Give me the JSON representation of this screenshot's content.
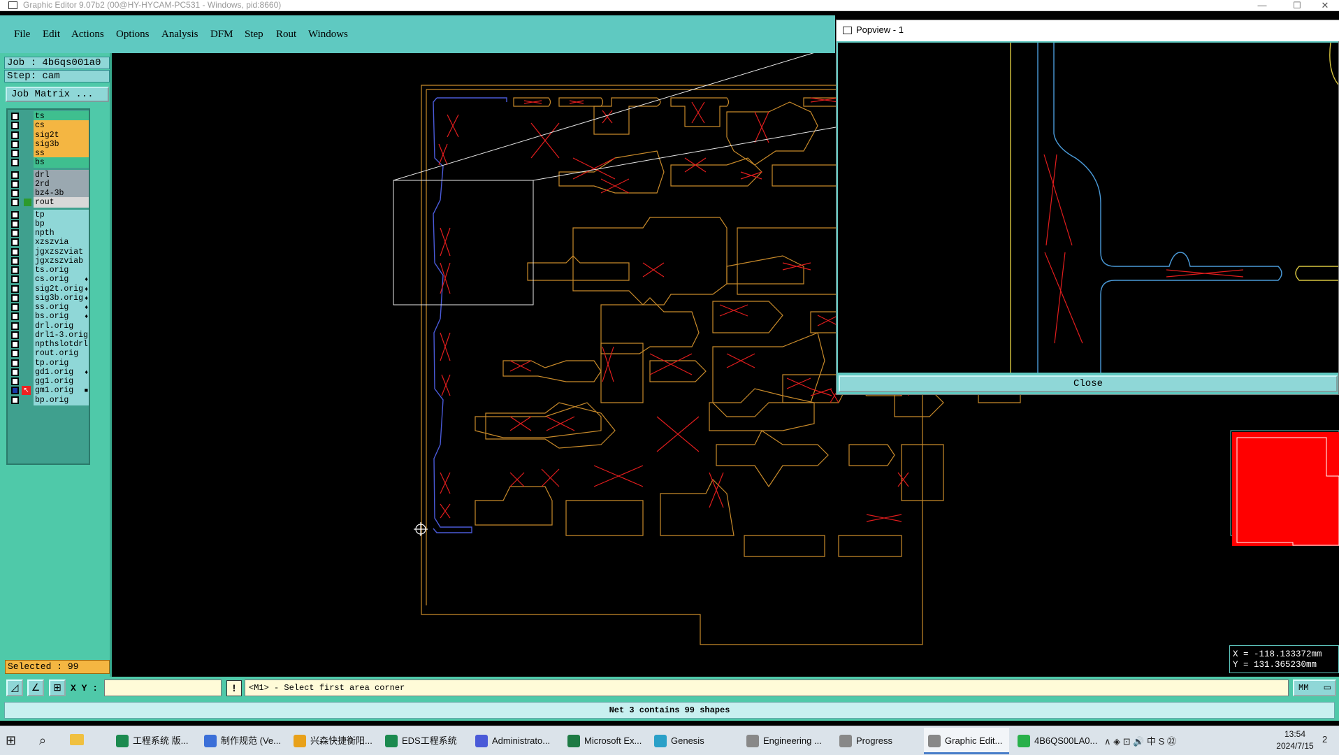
{
  "window": {
    "title": "Graphic Editor 9.07b2 (00@HY-HYCAM-PC531 - Windows, pid:8660)",
    "min_glyph": "—",
    "max_glyph": "☐",
    "close_glyph": "✕"
  },
  "menu": [
    "File",
    "Edit",
    "Actions",
    "Options",
    "Analysis",
    "DFM",
    "Step",
    "Rout",
    "Windows"
  ],
  "job": {
    "label": "Job : 4b6qs001a0",
    "step": "Step: cam",
    "matrix_button": "Job Matrix ..."
  },
  "layers": [
    {
      "name": "ts",
      "color": "#3fbf8f",
      "mark": "",
      "pointer": false
    },
    {
      "name": "cs",
      "color": "#f4b642",
      "mark": "",
      "pointer": false
    },
    {
      "name": "sig2t",
      "color": "#f4b642",
      "mark": "",
      "pointer": false
    },
    {
      "name": "sig3b",
      "color": "#f4b642",
      "mark": "",
      "pointer": false
    },
    {
      "name": "ss",
      "color": "#f4b642",
      "mark": "",
      "pointer": false
    },
    {
      "name": "bs",
      "color": "#3fbf8f",
      "mark": "",
      "pointer": false
    },
    {
      "name": "drl",
      "color": "#9aa8b0",
      "mark": "",
      "pointer": false
    },
    {
      "name": "2rd",
      "color": "#9aa8b0",
      "mark": "",
      "pointer": false
    },
    {
      "name": "bz4-3b",
      "color": "#9aa8b0",
      "mark": "",
      "pointer": false
    },
    {
      "name": "rout",
      "color": "#d8d8d8",
      "mark": "",
      "pointer": false,
      "active": true
    },
    {
      "name": "tp",
      "color": "#8fd7d7",
      "mark": "",
      "pointer": false
    },
    {
      "name": "bp",
      "color": "#8fd7d7",
      "mark": "",
      "pointer": false
    },
    {
      "name": "npth",
      "color": "#8fd7d7",
      "mark": "",
      "pointer": false
    },
    {
      "name": "xzszvia",
      "color": "#8fd7d7",
      "mark": "",
      "pointer": false
    },
    {
      "name": "jgxzszviat",
      "color": "#8fd7d7",
      "mark": "",
      "pointer": false
    },
    {
      "name": "jgxzszviab",
      "color": "#8fd7d7",
      "mark": "",
      "pointer": false
    },
    {
      "name": "ts.orig",
      "color": "#8fd7d7",
      "mark": "",
      "pointer": false
    },
    {
      "name": "cs.orig",
      "color": "#8fd7d7",
      "mark": "♦",
      "pointer": false
    },
    {
      "name": "sig2t.orig",
      "color": "#8fd7d7",
      "mark": "♦",
      "pointer": false
    },
    {
      "name": "sig3b.orig",
      "color": "#8fd7d7",
      "mark": "♦",
      "pointer": false
    },
    {
      "name": "ss.orig",
      "color": "#8fd7d7",
      "mark": "♦",
      "pointer": false
    },
    {
      "name": "bs.orig",
      "color": "#8fd7d7",
      "mark": "♦",
      "pointer": false
    },
    {
      "name": "drl.orig",
      "color": "#8fd7d7",
      "mark": "",
      "pointer": false
    },
    {
      "name": "drl1-3.orig",
      "color": "#8fd7d7",
      "mark": "",
      "pointer": false
    },
    {
      "name": "npthslotdrl",
      "color": "#8fd7d7",
      "mark": "",
      "pointer": false
    },
    {
      "name": "rout.orig",
      "color": "#8fd7d7",
      "mark": "",
      "pointer": false
    },
    {
      "name": "tp.orig",
      "color": "#8fd7d7",
      "mark": "",
      "pointer": false
    },
    {
      "name": "gd1.orig",
      "color": "#8fd7d7",
      "mark": "♦",
      "pointer": false
    },
    {
      "name": "gg1.orig",
      "color": "#8fd7d7",
      "mark": "",
      "pointer": false
    },
    {
      "name": "gm1.orig",
      "color": "#8fd7d7",
      "mark": "■",
      "pointer": true
    },
    {
      "name": "bp.orig",
      "color": "#8fd7d7",
      "mark": "",
      "pointer": false
    }
  ],
  "selected": "Selected : 99",
  "popview": {
    "title": "Popview - 1",
    "close_label": "Close"
  },
  "coords": {
    "x": "X = -118.133372mm",
    "y": "Y = 131.365230mm"
  },
  "cmd": {
    "xy_label": "X Y :",
    "xy_value": "",
    "bang": "!",
    "prompt": "<M1> - Select first area corner",
    "unit": "MM"
  },
  "status": "Net 3 contains 99 shapes",
  "colors": {
    "profile": "#c88a2a",
    "rout_blue": "#4a5ad8",
    "cut_red": "#e11d1d",
    "popview_bg": "#5fc9c1",
    "panel": "#4fc9a9"
  },
  "taskbar": {
    "items": [
      {
        "label": "工程系统 版...",
        "icon_color": "#1b8a4f",
        "active": false
      },
      {
        "label": "制作规范 (Ve...",
        "icon_color": "#3b6fd8",
        "active": false
      },
      {
        "label": "兴森快捷衡阳...",
        "icon_color": "#e8a11a",
        "active": false
      },
      {
        "label": "EDS工程系统",
        "icon_color": "#1b8a4f",
        "active": false
      },
      {
        "label": "Administrato...",
        "icon_color": "#4a5ad8",
        "active": false
      },
      {
        "label": "Microsoft Ex...",
        "icon_color": "#1d7a44",
        "active": false
      },
      {
        "label": "Genesis",
        "icon_color": "#2aa0c8",
        "active": false
      },
      {
        "label": "Engineering ...",
        "icon_color": "#888888",
        "active": false
      },
      {
        "label": "Progress",
        "icon_color": "#888888",
        "active": false
      },
      {
        "label": "Graphic Edit...",
        "icon_color": "#888888",
        "active": true
      },
      {
        "label": "4B6QS00LA0...",
        "icon_color": "#28b04a",
        "active": false
      }
    ],
    "tray": "∧ ◈ ⊡ 🔊 中 S ㉒",
    "time": "13:54",
    "date": "2024/7/15",
    "notify": "2"
  }
}
